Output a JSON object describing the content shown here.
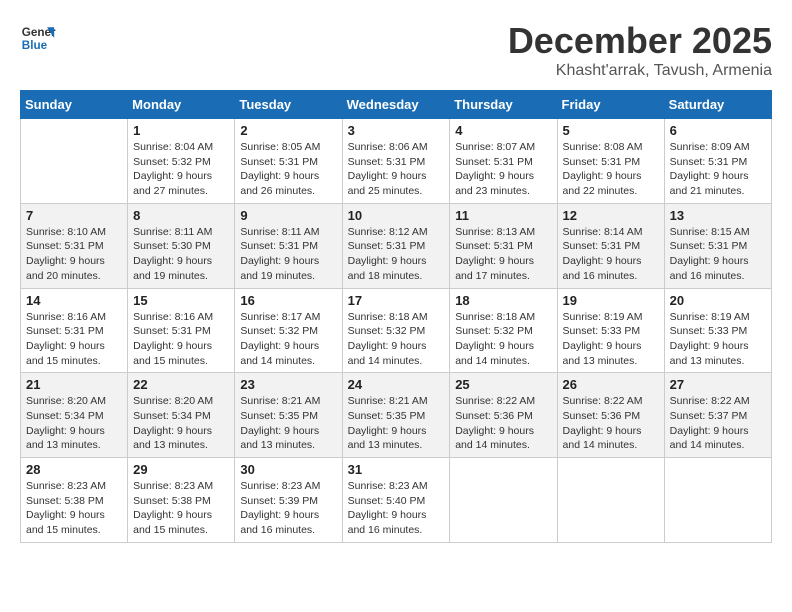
{
  "logo": {
    "line1": "General",
    "line2": "Blue"
  },
  "title": "December 2025",
  "subtitle": "Khasht'arrak, Tavush, Armenia",
  "days_of_week": [
    "Sunday",
    "Monday",
    "Tuesday",
    "Wednesday",
    "Thursday",
    "Friday",
    "Saturday"
  ],
  "weeks": [
    [
      {
        "day": "",
        "info": ""
      },
      {
        "day": "1",
        "info": "Sunrise: 8:04 AM\nSunset: 5:32 PM\nDaylight: 9 hours\nand 27 minutes."
      },
      {
        "day": "2",
        "info": "Sunrise: 8:05 AM\nSunset: 5:31 PM\nDaylight: 9 hours\nand 26 minutes."
      },
      {
        "day": "3",
        "info": "Sunrise: 8:06 AM\nSunset: 5:31 PM\nDaylight: 9 hours\nand 25 minutes."
      },
      {
        "day": "4",
        "info": "Sunrise: 8:07 AM\nSunset: 5:31 PM\nDaylight: 9 hours\nand 23 minutes."
      },
      {
        "day": "5",
        "info": "Sunrise: 8:08 AM\nSunset: 5:31 PM\nDaylight: 9 hours\nand 22 minutes."
      },
      {
        "day": "6",
        "info": "Sunrise: 8:09 AM\nSunset: 5:31 PM\nDaylight: 9 hours\nand 21 minutes."
      }
    ],
    [
      {
        "day": "7",
        "info": "Sunrise: 8:10 AM\nSunset: 5:31 PM\nDaylight: 9 hours\nand 20 minutes."
      },
      {
        "day": "8",
        "info": "Sunrise: 8:11 AM\nSunset: 5:30 PM\nDaylight: 9 hours\nand 19 minutes."
      },
      {
        "day": "9",
        "info": "Sunrise: 8:11 AM\nSunset: 5:31 PM\nDaylight: 9 hours\nand 19 minutes."
      },
      {
        "day": "10",
        "info": "Sunrise: 8:12 AM\nSunset: 5:31 PM\nDaylight: 9 hours\nand 18 minutes."
      },
      {
        "day": "11",
        "info": "Sunrise: 8:13 AM\nSunset: 5:31 PM\nDaylight: 9 hours\nand 17 minutes."
      },
      {
        "day": "12",
        "info": "Sunrise: 8:14 AM\nSunset: 5:31 PM\nDaylight: 9 hours\nand 16 minutes."
      },
      {
        "day": "13",
        "info": "Sunrise: 8:15 AM\nSunset: 5:31 PM\nDaylight: 9 hours\nand 16 minutes."
      }
    ],
    [
      {
        "day": "14",
        "info": "Sunrise: 8:16 AM\nSunset: 5:31 PM\nDaylight: 9 hours\nand 15 minutes."
      },
      {
        "day": "15",
        "info": "Sunrise: 8:16 AM\nSunset: 5:31 PM\nDaylight: 9 hours\nand 15 minutes."
      },
      {
        "day": "16",
        "info": "Sunrise: 8:17 AM\nSunset: 5:32 PM\nDaylight: 9 hours\nand 14 minutes."
      },
      {
        "day": "17",
        "info": "Sunrise: 8:18 AM\nSunset: 5:32 PM\nDaylight: 9 hours\nand 14 minutes."
      },
      {
        "day": "18",
        "info": "Sunrise: 8:18 AM\nSunset: 5:32 PM\nDaylight: 9 hours\nand 14 minutes."
      },
      {
        "day": "19",
        "info": "Sunrise: 8:19 AM\nSunset: 5:33 PM\nDaylight: 9 hours\nand 13 minutes."
      },
      {
        "day": "20",
        "info": "Sunrise: 8:19 AM\nSunset: 5:33 PM\nDaylight: 9 hours\nand 13 minutes."
      }
    ],
    [
      {
        "day": "21",
        "info": "Sunrise: 8:20 AM\nSunset: 5:34 PM\nDaylight: 9 hours\nand 13 minutes."
      },
      {
        "day": "22",
        "info": "Sunrise: 8:20 AM\nSunset: 5:34 PM\nDaylight: 9 hours\nand 13 minutes."
      },
      {
        "day": "23",
        "info": "Sunrise: 8:21 AM\nSunset: 5:35 PM\nDaylight: 9 hours\nand 13 minutes."
      },
      {
        "day": "24",
        "info": "Sunrise: 8:21 AM\nSunset: 5:35 PM\nDaylight: 9 hours\nand 13 minutes."
      },
      {
        "day": "25",
        "info": "Sunrise: 8:22 AM\nSunset: 5:36 PM\nDaylight: 9 hours\nand 14 minutes."
      },
      {
        "day": "26",
        "info": "Sunrise: 8:22 AM\nSunset: 5:36 PM\nDaylight: 9 hours\nand 14 minutes."
      },
      {
        "day": "27",
        "info": "Sunrise: 8:22 AM\nSunset: 5:37 PM\nDaylight: 9 hours\nand 14 minutes."
      }
    ],
    [
      {
        "day": "28",
        "info": "Sunrise: 8:23 AM\nSunset: 5:38 PM\nDaylight: 9 hours\nand 15 minutes."
      },
      {
        "day": "29",
        "info": "Sunrise: 8:23 AM\nSunset: 5:38 PM\nDaylight: 9 hours\nand 15 minutes."
      },
      {
        "day": "30",
        "info": "Sunrise: 8:23 AM\nSunset: 5:39 PM\nDaylight: 9 hours\nand 16 minutes."
      },
      {
        "day": "31",
        "info": "Sunrise: 8:23 AM\nSunset: 5:40 PM\nDaylight: 9 hours\nand 16 minutes."
      },
      {
        "day": "",
        "info": ""
      },
      {
        "day": "",
        "info": ""
      },
      {
        "day": "",
        "info": ""
      }
    ]
  ]
}
